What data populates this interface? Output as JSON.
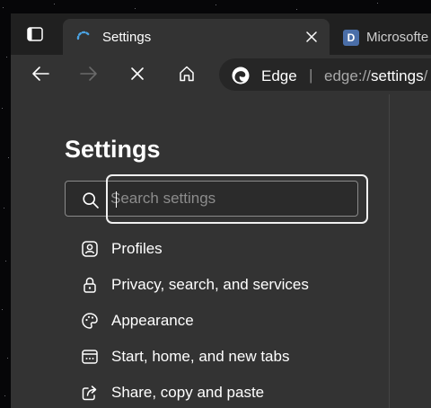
{
  "tabs": [
    {
      "title": "Settings",
      "active": true,
      "loading": true
    },
    {
      "title": "Microsofte",
      "active": false,
      "favicon_letter": "D"
    }
  ],
  "toolbar": {
    "brand_label": "Edge",
    "separator": "|",
    "url_scheme": "edge://",
    "url_host": "settings",
    "url_rest": "/"
  },
  "settings": {
    "title": "Settings",
    "search_placeholder": "Search settings",
    "nav_items": [
      {
        "label": "Profiles",
        "icon": "profile-icon"
      },
      {
        "label": "Privacy, search, and services",
        "icon": "lock-icon"
      },
      {
        "label": "Appearance",
        "icon": "palette-icon"
      },
      {
        "label": "Start, home, and new tabs",
        "icon": "home-tabs-icon"
      },
      {
        "label": "Share, copy and paste",
        "icon": "share-icon"
      }
    ]
  },
  "colors": {
    "desktop": "#060608",
    "tabstrip": "#202020",
    "content": "#333333",
    "addressbar": "#262626",
    "focus_ring": "#f0f0f0",
    "loading_spinner": "#4ba3e3"
  }
}
